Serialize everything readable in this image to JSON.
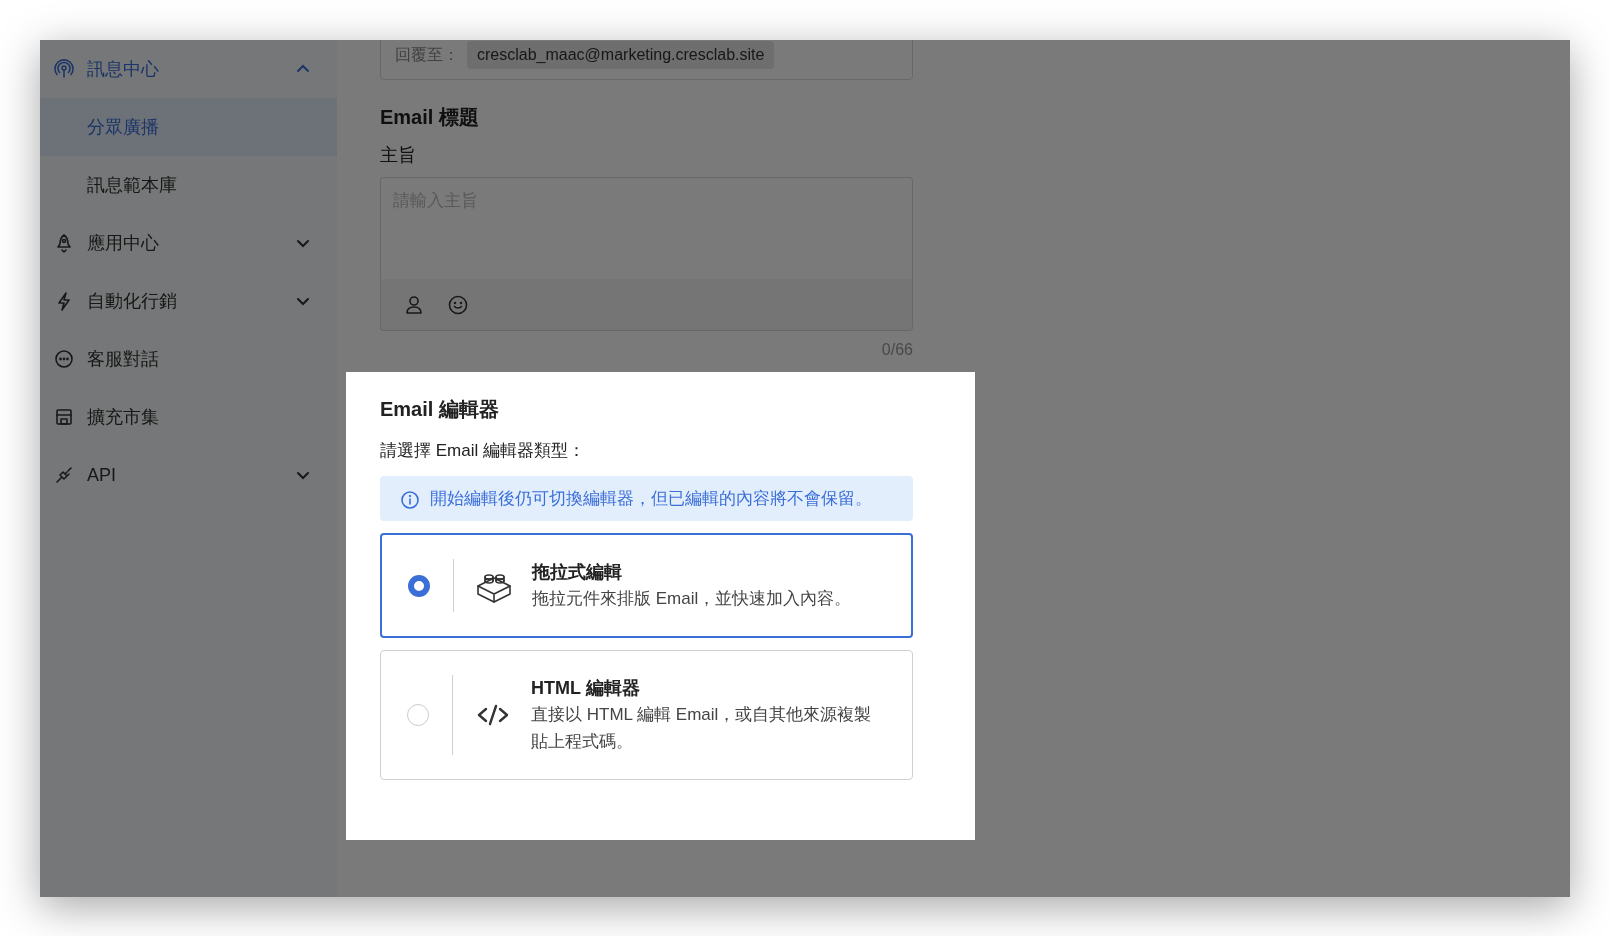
{
  "sidebar": {
    "items": [
      {
        "label": "訊息中心",
        "kind": "group",
        "expanded": true,
        "children": [
          {
            "label": "分眾廣播",
            "selected": true
          },
          {
            "label": "訊息範本庫",
            "selected": false
          }
        ]
      },
      {
        "label": "應用中心",
        "kind": "group",
        "expanded": false
      },
      {
        "label": "自動化行銷",
        "kind": "group",
        "expanded": false
      },
      {
        "label": "客服對話",
        "kind": "link"
      },
      {
        "label": "擴充市集",
        "kind": "link"
      },
      {
        "label": "API",
        "kind": "group",
        "expanded": false
      }
    ]
  },
  "reply_to": {
    "label": "回覆至：",
    "value": "cresclab_maac@marketing.cresclab.site"
  },
  "email_title": {
    "heading": "Email 標題",
    "subject_label": "主旨",
    "placeholder": "請輸入主旨",
    "counter": "0/66"
  },
  "modal": {
    "title": "Email 編輯器",
    "prompt": "請選擇 Email 編輯器類型：",
    "notice": "開始編輯後仍可切換編輯器，但已編輯的內容將不會保留。",
    "options": [
      {
        "title": "拖拉式編輯",
        "description": "拖拉元件來排版 Email，並快速加入內容。",
        "selected": true
      },
      {
        "title": "HTML 編輯器",
        "description": "直接以 HTML 編輯 Email，或自其他來源複製貼上程式碼。",
        "selected": false
      }
    ]
  }
}
